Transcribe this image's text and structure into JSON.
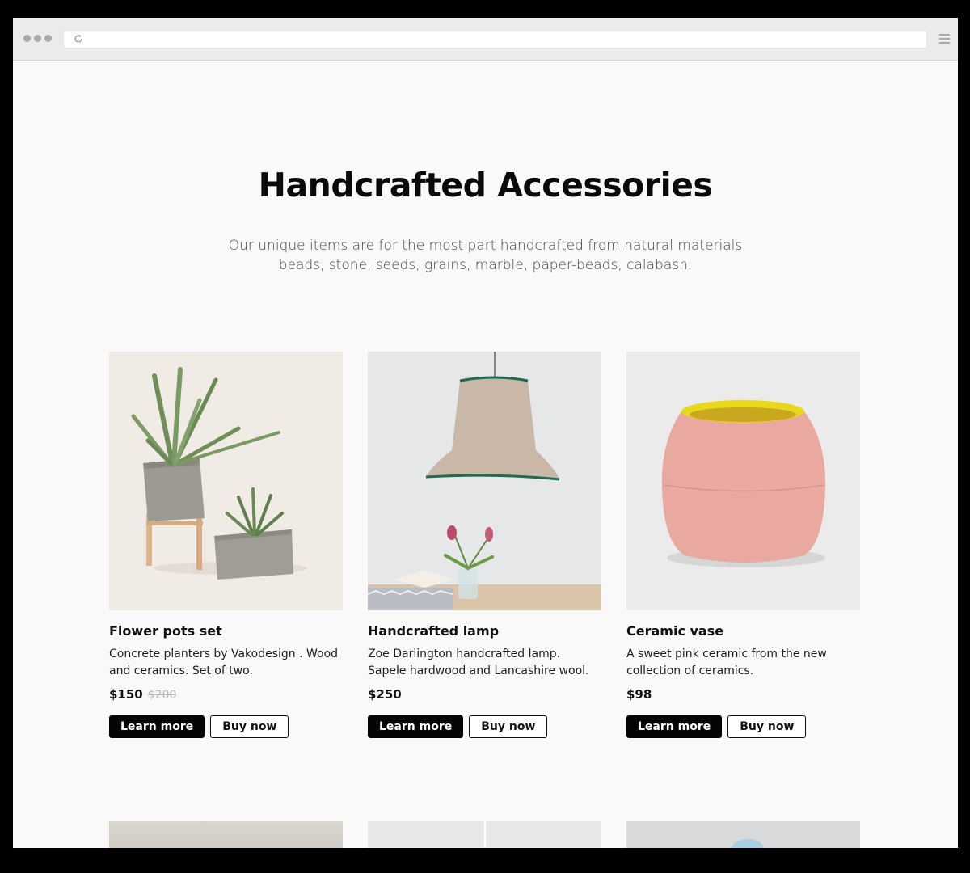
{
  "page": {
    "title": "Handcrafted Accessories",
    "subtitle_line1": "Our unique items are for the most part handcrafted from natural materials",
    "subtitle_line2": "beads, stone, seeds, grains, marble, paper-beads, calabash."
  },
  "products": [
    {
      "name": "Flower pots set",
      "desc_line1": "Concrete planters by Vakodesign . Wood",
      "desc_line2": "and ceramics. Set of two.",
      "price": "$150",
      "old_price": "$200",
      "learn_label": "Learn more",
      "buy_label": "Buy now"
    },
    {
      "name": "Handcrafted lamp",
      "desc_line1": "Zoe Darlington handcrafted lamp.",
      "desc_line2": "Sapele hardwood and Lancashire wool.",
      "price": "$250",
      "old_price": "",
      "learn_label": "Learn more",
      "buy_label": "Buy now"
    },
    {
      "name": "Ceramic vase",
      "desc_line1": "A sweet pink ceramic from the new",
      "desc_line2": "collection of ceramics.",
      "price": "$98",
      "old_price": "",
      "learn_label": "Learn more",
      "buy_label": "Buy now"
    }
  ],
  "icons": {
    "reload": "reload-icon",
    "menu": "hamburger-menu-icon"
  }
}
